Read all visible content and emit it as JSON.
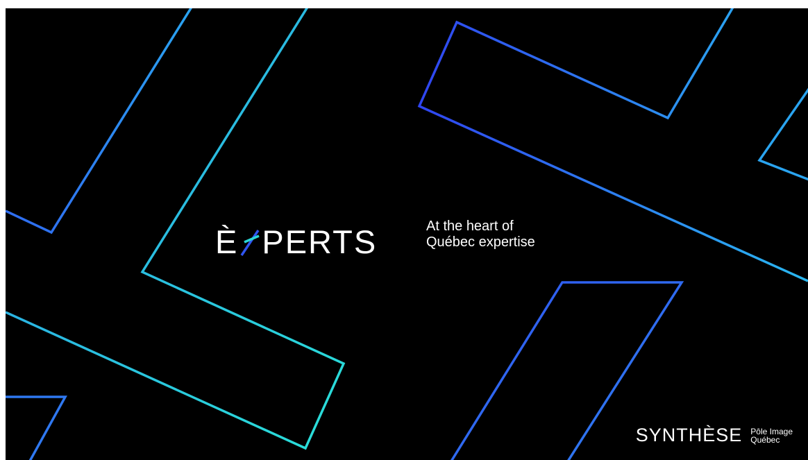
{
  "slide": {
    "logo": {
      "text_before": "È",
      "text_after": "PERTS"
    },
    "tagline": {
      "line1": "At the heart of",
      "line2": "Québec expertise"
    },
    "partner": {
      "name": "SYNTHÈSE",
      "sub_line1": "Pôle Image",
      "sub_line2": "Québec"
    }
  },
  "colors": {
    "background": "#000000",
    "line_cyan": "#2ad6d6",
    "line_sky": "#2aa4f0",
    "line_blue": "#2f55f0",
    "text": "#ffffff"
  }
}
